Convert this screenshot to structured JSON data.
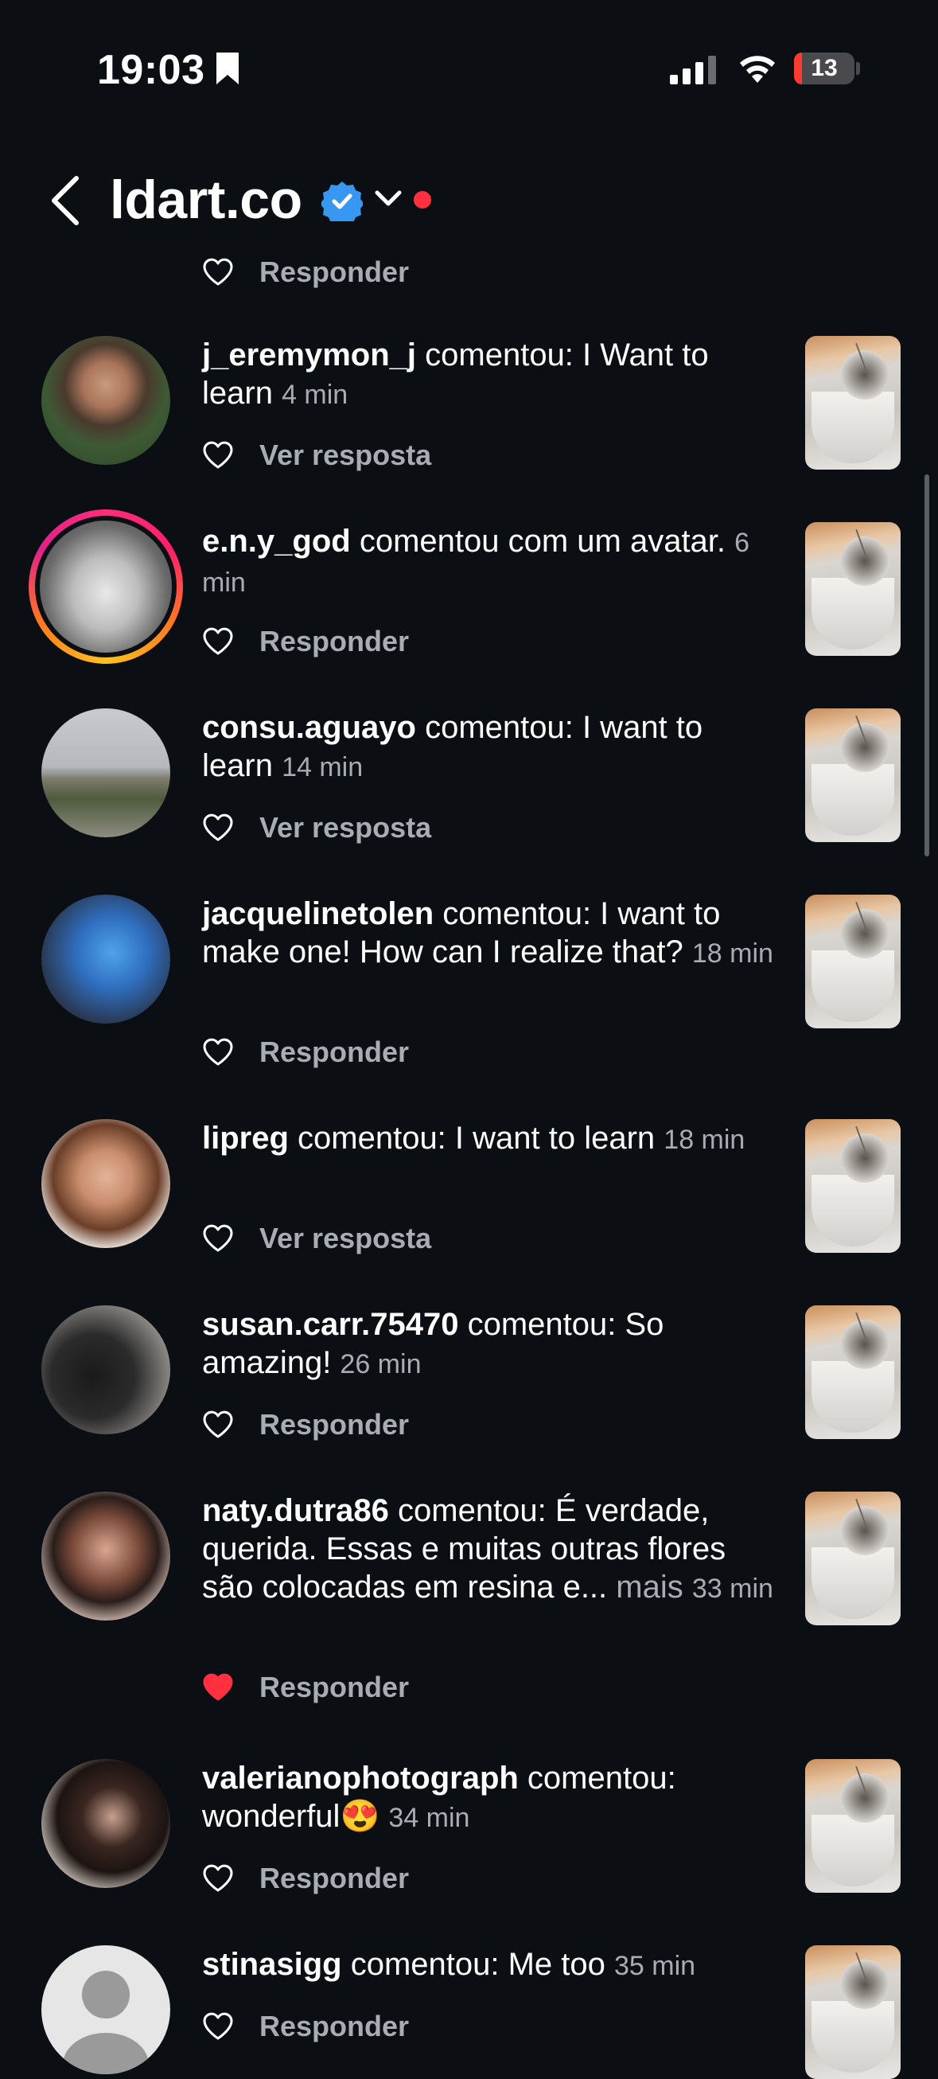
{
  "status_bar": {
    "time": "19:03",
    "battery": "13"
  },
  "header": {
    "title": "ldart.co"
  },
  "partial_row": {
    "action": "Responder"
  },
  "notifications": [
    {
      "username": "j_eremymon_j",
      "text": " comentou: I Want to learn ",
      "time": "4 min",
      "action": "Ver resposta",
      "liked": false
    },
    {
      "username": "e.n.y_god",
      "text": " comentou com um avatar. ",
      "time": "6 min",
      "action": "Responder",
      "liked": false
    },
    {
      "username": "consu.aguayo",
      "text": " comentou: I want to learn ",
      "time": "14 min",
      "action": "Ver resposta",
      "liked": false
    },
    {
      "username": "jacquelinetolen",
      "text": " comentou: I want to make one! How can I realize that? ",
      "time": "18 min",
      "action": "Responder",
      "liked": false
    },
    {
      "username": "lipreg",
      "text": " comentou: I want to learn ",
      "time": "18 min",
      "action": "Ver resposta",
      "liked": false
    },
    {
      "username": "susan.carr.75470",
      "text": " comentou: So amazing! ",
      "time": "26 min",
      "action": "Responder",
      "liked": false
    },
    {
      "username": "naty.dutra86",
      "text": " comentou: É verdade, querida. Essas e muitas outras flores são colocadas em resina e... ",
      "more": "mais",
      "time": "33 min",
      "action": "Responder",
      "liked": true
    },
    {
      "username": "valerianophotograph",
      "text": " comentou: wonderful",
      "emoji": "😍",
      "time": "34 min",
      "action": "Responder",
      "liked": false
    },
    {
      "username": "stinasigg",
      "text": " comentou: Me too ",
      "time": "35 min",
      "action": "Responder",
      "liked": false
    }
  ]
}
